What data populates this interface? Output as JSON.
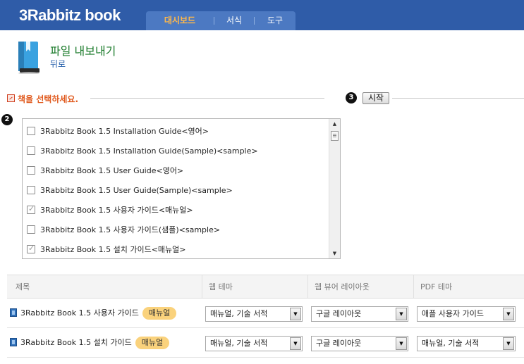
{
  "app": {
    "logo": "3Rabbitz book"
  },
  "nav": {
    "items": [
      "대시보드",
      "서식",
      "도구"
    ],
    "active_index": 0
  },
  "page": {
    "title": "파일 내보내기",
    "back": "뒤로"
  },
  "section": {
    "title": "책을 선택하세요.",
    "step2": "2",
    "step3": "3",
    "start_button": "시작"
  },
  "book_list": [
    {
      "label": "3Rabbitz Book 1.5 Installation Guide<영어>",
      "checked": false
    },
    {
      "label": "3Rabbitz Book 1.5 Installation Guide(Sample)<sample>",
      "checked": false
    },
    {
      "label": "3Rabbitz Book 1.5 User Guide<영어>",
      "checked": false
    },
    {
      "label": "3Rabbitz Book 1.5 User Guide(Sample)<sample>",
      "checked": false
    },
    {
      "label": "3Rabbitz Book 1.5 사용자 가이드<매뉴얼>",
      "checked": true
    },
    {
      "label": "3Rabbitz Book 1.5 사용자 가이드(샘플)<sample>",
      "checked": false
    },
    {
      "label": "3Rabbitz Book 1.5 설치 가이드<매뉴얼>",
      "checked": true
    }
  ],
  "table": {
    "headers": [
      "제목",
      "웹 테마",
      "웹 뷰어 레이아웃",
      "PDF 테마"
    ],
    "rows": [
      {
        "title": "3Rabbitz Book 1.5 사용자 가이드",
        "badge": "매뉴얼",
        "web_theme": "매뉴얼, 기술 서적",
        "viewer_layout": "구글 레이아웃",
        "pdf_theme": "애플 사용자 가이드"
      },
      {
        "title": "3Rabbitz Book 1.5 설치 가이드",
        "badge": "매뉴얼",
        "web_theme": "매뉴얼, 기술 서적",
        "viewer_layout": "구글 레이아웃",
        "pdf_theme": "매뉴얼, 기술 서적"
      }
    ]
  },
  "colors": {
    "header_bg": "#2f5ca8",
    "nav_active": "#ffb84a",
    "title_green": "#1a7a2a",
    "section_orange": "#e05a1e",
    "badge_bg": "#fad27c"
  }
}
